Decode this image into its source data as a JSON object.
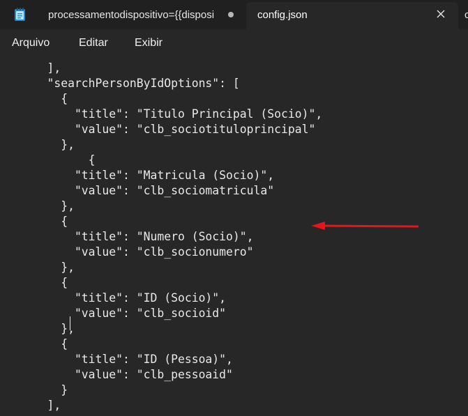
{
  "window": {
    "tabs": [
      {
        "label": "processamentodispositivo={{disposi",
        "modified": true
      },
      {
        "label": "config.json",
        "active": true
      },
      {
        "label": "co"
      }
    ]
  },
  "menu": {
    "items": [
      "Arquivo",
      "Editar",
      "Exibir"
    ]
  },
  "editor": {
    "lines": [
      "    ],",
      "    \"searchPersonByIdOptions\": [",
      "      {",
      "        \"title\": \"Titulo Principal (Socio)\",",
      "        \"value\": \"clb_sociotituloprincipal\"",
      "      },",
      "          {",
      "        \"title\": \"Matricula (Socio)\",",
      "        \"value\": \"clb_sociomatricula\"",
      "      },",
      "      {",
      "        \"title\": \"Numero (Socio)\",",
      "        \"value\": \"clb_socionumero\"",
      "      },",
      "      {",
      "        \"title\": \"ID (Socio)\",",
      "        \"value\": \"clb_socioid\"",
      "      },",
      "      {",
      "        \"title\": \"ID (Pessoa)\",",
      "        \"value\": \"clb_pessoaid\"",
      "      }",
      "    ],"
    ]
  },
  "colors": {
    "annotation_arrow": "#e8141b",
    "background": "#272727",
    "tabbar": "#202020"
  },
  "icons": {
    "app": "notepad-icon",
    "close": "close-icon"
  }
}
